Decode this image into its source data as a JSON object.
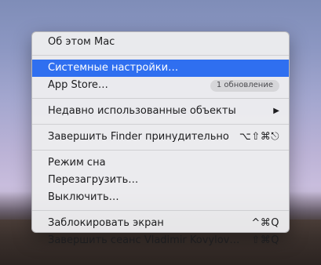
{
  "menu": {
    "about": "Об этом Mac",
    "system_prefs": "Системные настройки…",
    "app_store": "App Store…",
    "app_store_badge": "1 обновление",
    "recent_items": "Недавно использованные объекты",
    "force_quit": "Завершить Finder принудительно",
    "force_quit_shortcut": "⌥⇧⌘⎋",
    "sleep": "Режим сна",
    "restart": "Перезагрузить…",
    "shutdown": "Выключить…",
    "lock_screen": "Заблокировать экран",
    "lock_screen_shortcut": "^⌘Q",
    "logout": "Завершить сеанс Vladimir Kovylov…",
    "logout_shortcut": "⇧⌘Q"
  }
}
